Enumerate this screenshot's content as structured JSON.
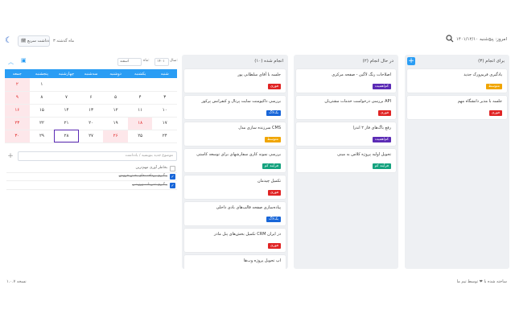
{
  "header": {
    "greeting": "امروز: پنج‌شنبه ۱۴۰۱/۱۲/۱۰",
    "quick_add": "🗓 یادداشت سریع",
    "range": "۳ ماه گذشته",
    "search_icon": "search-icon",
    "theme_icon": "moon-icon"
  },
  "columns": [
    {
      "title": "برای انجام (۳)",
      "add_label": "+",
      "cards": [
        {
          "text": "یادگیری فریم‌ورک جدید",
          "tag": "متوسط",
          "color": "orange"
        },
        {
          "text": "جلسه با مدیر دانشگاه مهم",
          "tag": "فوری",
          "color": "red"
        }
      ]
    },
    {
      "title": "در حال انجام (۲)",
      "cards": [
        {
          "text": "اصلاحات رنگ لاگین - صفحه مرکزی",
          "tag": "کم‌اهمیت",
          "color": "purple"
        },
        {
          "text": "بررسی درخواست خدمات مشتریان API",
          "tag": "فوری",
          "color": "red"
        },
        {
          "text": "رفع باگ‌های فاز ۲ اندرا",
          "tag": "کم‌اهمیت",
          "color": "purple"
        },
        {
          "text": "تحویل اولیه پروژه کلاس به مینی",
          "tag": "فرآیند کم",
          "color": "green"
        }
      ]
    },
    {
      "title": "انجام شده (۱۰)",
      "cards": [
        {
          "text": "جلسه با آقای سلطانی پور",
          "tag": "فوری",
          "color": "red"
        },
        {
          "text": "بررسی داکیومنت سایت پرتال و کنفرانس پرکور",
          "tag": "بک‌لاگ",
          "color": "blue"
        },
        {
          "text": "سرزنده سازی مدل CMS",
          "tag": "متوسط",
          "color": "orange"
        },
        {
          "text": "بررسی نمونه کاری سفارشهای برای توسعه کاستی",
          "tag": "فرآیند کم",
          "color": "green"
        },
        {
          "text": "تکمیل چیدمان",
          "tag": "فوری",
          "color": "red"
        },
        {
          "text": "پیاده‌سازی صفحه قالب‌های بادی داخلی",
          "tag": "بک‌لاگ",
          "color": "blue"
        },
        {
          "text": "تکمیل بخش‌های پنل مادر CRM در ایران",
          "tag": "فوری",
          "color": "red"
        },
        {
          "text": "اپ تحویل پروژه وب‌ها",
          "tag": "",
          "color": "none"
        }
      ]
    }
  ],
  "calendar": {
    "month_label": "ماه:",
    "month_value": "اسفند",
    "year_label": "سال:",
    "year_value": "۱۴۰۱",
    "weekdays": [
      "شنبه",
      "یکشنبه",
      "دوشنبه",
      "سه‌شنبه",
      "چهارشنبه",
      "پنجشنبه",
      "جمعه"
    ],
    "weeks": [
      [
        "",
        "",
        "",
        "",
        "",
        "۱",
        "۲"
      ],
      [
        "۳",
        "۴",
        "۵",
        "۶",
        "۷",
        "۸",
        "۹"
      ],
      [
        "۱۰",
        "۱۱",
        "۱۲",
        "۱۳",
        "۱۴",
        "۱۵",
        "۱۶"
      ],
      [
        "۱۷",
        "۱۸",
        "۱۹",
        "۲۰",
        "۲۱",
        "۲۲",
        "۲۳"
      ],
      [
        "۲۴",
        "۲۵",
        "۲۶",
        "۲۷",
        "۲۸",
        "۲۹",
        "۳۰"
      ]
    ]
  },
  "todo": {
    "placeholder": "موضوع جدید بنویسید / یادداشت",
    "items": [
      {
        "text": "بخاطر آوری مهم‌ترین",
        "done": false
      },
      {
        "text": "پیگیری پرداخت‌های بخش فروش",
        "done": true
      },
      {
        "text": "پیگیری تمرینات ورزشی",
        "done": true
      }
    ]
  },
  "footer": {
    "version": "نسخه ۱.۰.۷",
    "credit": "ساخته شده با ❤ توسط تیم ما"
  },
  "colors": {
    "accent": "#2a9df4",
    "urgent": "#e02424",
    "low": "#5b2bb5",
    "medium": "#f0a500",
    "done": "#16a37f",
    "backlog": "#1866d8"
  }
}
